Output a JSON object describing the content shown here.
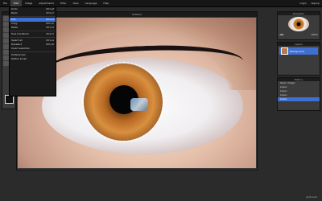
{
  "menubar": {
    "items": [
      "File",
      "Edit",
      "Image",
      "Adjustments",
      "Filter",
      "View",
      "Language",
      "Help"
    ],
    "active": "Edit",
    "right": [
      "Login",
      "Signup"
    ]
  },
  "edit_menu": {
    "items": [
      {
        "label": "Undo",
        "shortcut": "Ctrl+Z"
      },
      {
        "label": "Redo",
        "shortcut": "Ctrl+Y"
      },
      {
        "label": "Cut",
        "shortcut": "Ctrl+X",
        "highlight": true
      },
      {
        "label": "Copy",
        "shortcut": "Ctrl+C"
      },
      {
        "label": "Paste",
        "shortcut": "Ctrl+V"
      },
      {
        "label": "Free transform",
        "shortcut": "Ctrl+T"
      },
      {
        "label": "Select all",
        "shortcut": "Ctrl+A"
      },
      {
        "label": "Deselect",
        "shortcut": "Ctrl+D"
      },
      {
        "label": "Invert selection",
        "shortcut": ""
      },
      {
        "label": "Preferences",
        "shortcut": ""
      },
      {
        "label": "Define brush",
        "shortcut": ""
      }
    ]
  },
  "document": {
    "title": "Untitled"
  },
  "navigator": {
    "title": "Navigator",
    "zoom": "100%"
  },
  "layers": {
    "title": "Layers",
    "items": [
      "Background"
    ]
  },
  "history": {
    "title": "History",
    "items": [
      "Open image",
      "Lasso",
      "Lasso",
      "Lasso",
      "Lasso"
    ],
    "selected_index": 4
  },
  "footer": {
    "text": "pixlr.com"
  }
}
